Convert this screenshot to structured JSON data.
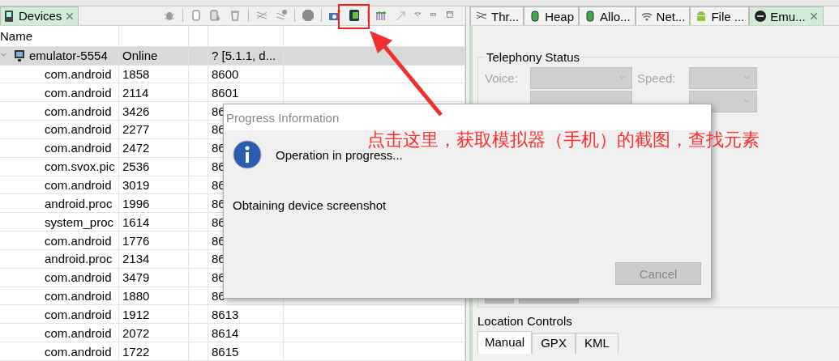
{
  "devices_view": {
    "tab": {
      "label": "Devices",
      "selected": true
    },
    "toolbar": [
      {
        "kind": "bug"
      },
      {
        "kind": "heap"
      },
      {
        "kind": "hprof"
      },
      {
        "kind": "gc"
      },
      {
        "kind": "threads"
      },
      {
        "kind": "method"
      },
      {
        "kind": "stop"
      },
      {
        "kind": "camera"
      },
      {
        "kind": "screenshot"
      },
      {
        "kind": "systrace"
      },
      {
        "kind": "trace"
      }
    ],
    "columns": [
      {
        "label": "Name"
      }
    ],
    "device": {
      "name": "emulator-5554",
      "status": "Online",
      "column_4": "? [5.1.1, d...",
      "expanded": true
    },
    "processes": [
      {
        "name": "com.android",
        "pid": "1858",
        "port": "8600"
      },
      {
        "name": "com.android",
        "pid": "2114",
        "port": "8601"
      },
      {
        "name": "com.android",
        "pid": "3426",
        "port": "86"
      },
      {
        "name": "com.android",
        "pid": "2277",
        "port": "86"
      },
      {
        "name": "com.android",
        "pid": "2472",
        "port": "86"
      },
      {
        "name": "com.svox.pic",
        "pid": "2536",
        "port": "86"
      },
      {
        "name": "com.android",
        "pid": "3019",
        "port": "86"
      },
      {
        "name": "android.proc",
        "pid": "1996",
        "port": "86"
      },
      {
        "name": "system_proc",
        "pid": "1614",
        "port": "86"
      },
      {
        "name": "com.android",
        "pid": "1776",
        "port": "86"
      },
      {
        "name": "android.proc",
        "pid": "2134",
        "port": "86"
      },
      {
        "name": "com.android",
        "pid": "3479",
        "port": "86"
      },
      {
        "name": "com.android",
        "pid": "1880",
        "port": "86"
      },
      {
        "name": "com.android",
        "pid": "1912",
        "port": "8613"
      },
      {
        "name": "com.android",
        "pid": "2072",
        "port": "8614"
      },
      {
        "name": "com.android",
        "pid": "1722",
        "port": "8615"
      }
    ]
  },
  "right_tabs": [
    {
      "label": "Thr...",
      "kind": "threads",
      "selected": false
    },
    {
      "label": "Heap",
      "kind": "heap",
      "selected": false
    },
    {
      "label": "Allo...",
      "kind": "heap",
      "selected": false
    },
    {
      "label": "Net...",
      "kind": "wifi",
      "selected": false
    },
    {
      "label": "File ...",
      "kind": "android",
      "selected": false
    },
    {
      "label": "Emu...",
      "kind": "emulator",
      "selected": true
    }
  ],
  "emulator_control": {
    "telephony": {
      "title": "Telephony Status",
      "fields": [
        {
          "label": "Voice:",
          "disabled": true
        },
        {
          "label": "Speed:",
          "disabled": true
        }
      ]
    },
    "location": {
      "title": "Location Controls",
      "tabs": [
        {
          "label": "Manual",
          "selected": true
        },
        {
          "label": "GPX",
          "selected": false
        },
        {
          "label": "KML",
          "selected": false
        }
      ]
    }
  },
  "dialog": {
    "title": "Progress Information",
    "message": "Operation in progress...",
    "detail": "Obtaining device screenshot",
    "cancel": {
      "label": "Cancel",
      "disabled": true
    }
  },
  "annotation": {
    "text": "点击这里，获取模拟器（手机）的截图，查找元素"
  }
}
